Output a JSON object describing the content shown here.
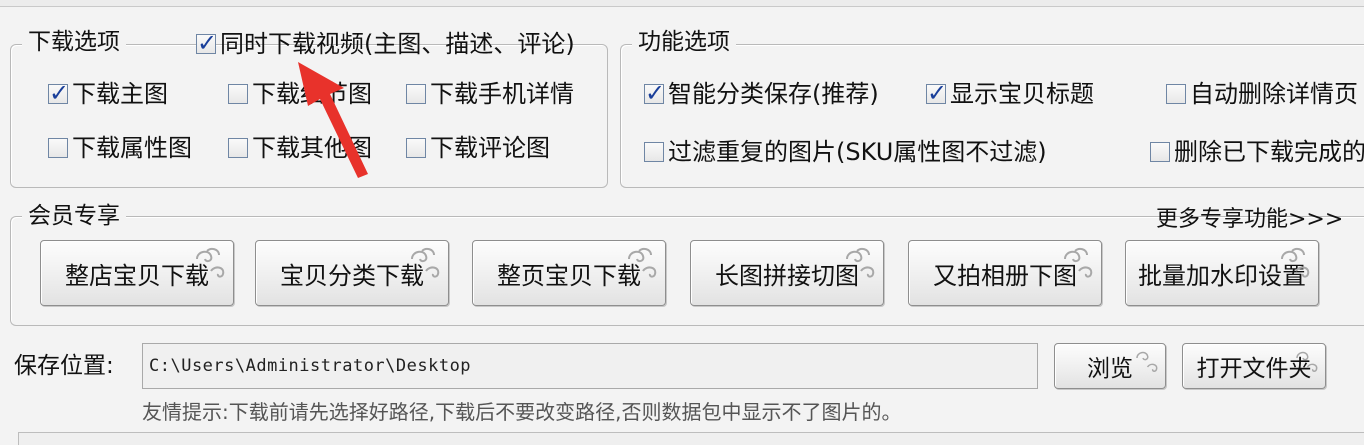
{
  "download_group": {
    "title": "下载选项",
    "video_option": {
      "label": "同时下载视频(主图、描述、评论)",
      "checked": true
    },
    "options": [
      {
        "label": "下载主图",
        "checked": true
      },
      {
        "label": "下载细节图",
        "checked": false
      },
      {
        "label": "下载手机详情",
        "checked": false
      },
      {
        "label": "下载属性图",
        "checked": false
      },
      {
        "label": "下载其他图",
        "checked": false
      },
      {
        "label": "下载评论图",
        "checked": false
      }
    ]
  },
  "function_group": {
    "title": "功能选项",
    "options": [
      {
        "label": "智能分类保存(推荐)",
        "checked": true
      },
      {
        "label": "显示宝贝标题",
        "checked": true
      },
      {
        "label": "自动删除详情页",
        "checked": false
      },
      {
        "label": "过滤重复的图片(SKU属性图不过滤)",
        "checked": false
      },
      {
        "label": "删除已下载完成的",
        "checked": false
      }
    ]
  },
  "member_group": {
    "title": "会员专享",
    "more_link": "更多专享功能>>>",
    "buttons": [
      "整店宝贝下载",
      "宝贝分类下载",
      "整页宝贝下载",
      "长图拼接切图",
      "又拍相册下图",
      "批量加水印设置"
    ]
  },
  "save": {
    "label": "保存位置:",
    "path": "C:\\Users\\Administrator\\Desktop",
    "browse": "浏览",
    "open_folder": "打开文件夹",
    "tip": "友情提示:下载前请先选择好路径,下载后不要改变路径,否则数据包中显示不了图片的。"
  },
  "colors": {
    "annotation_arrow": "#e8322b",
    "check": "#1a3f9a"
  }
}
